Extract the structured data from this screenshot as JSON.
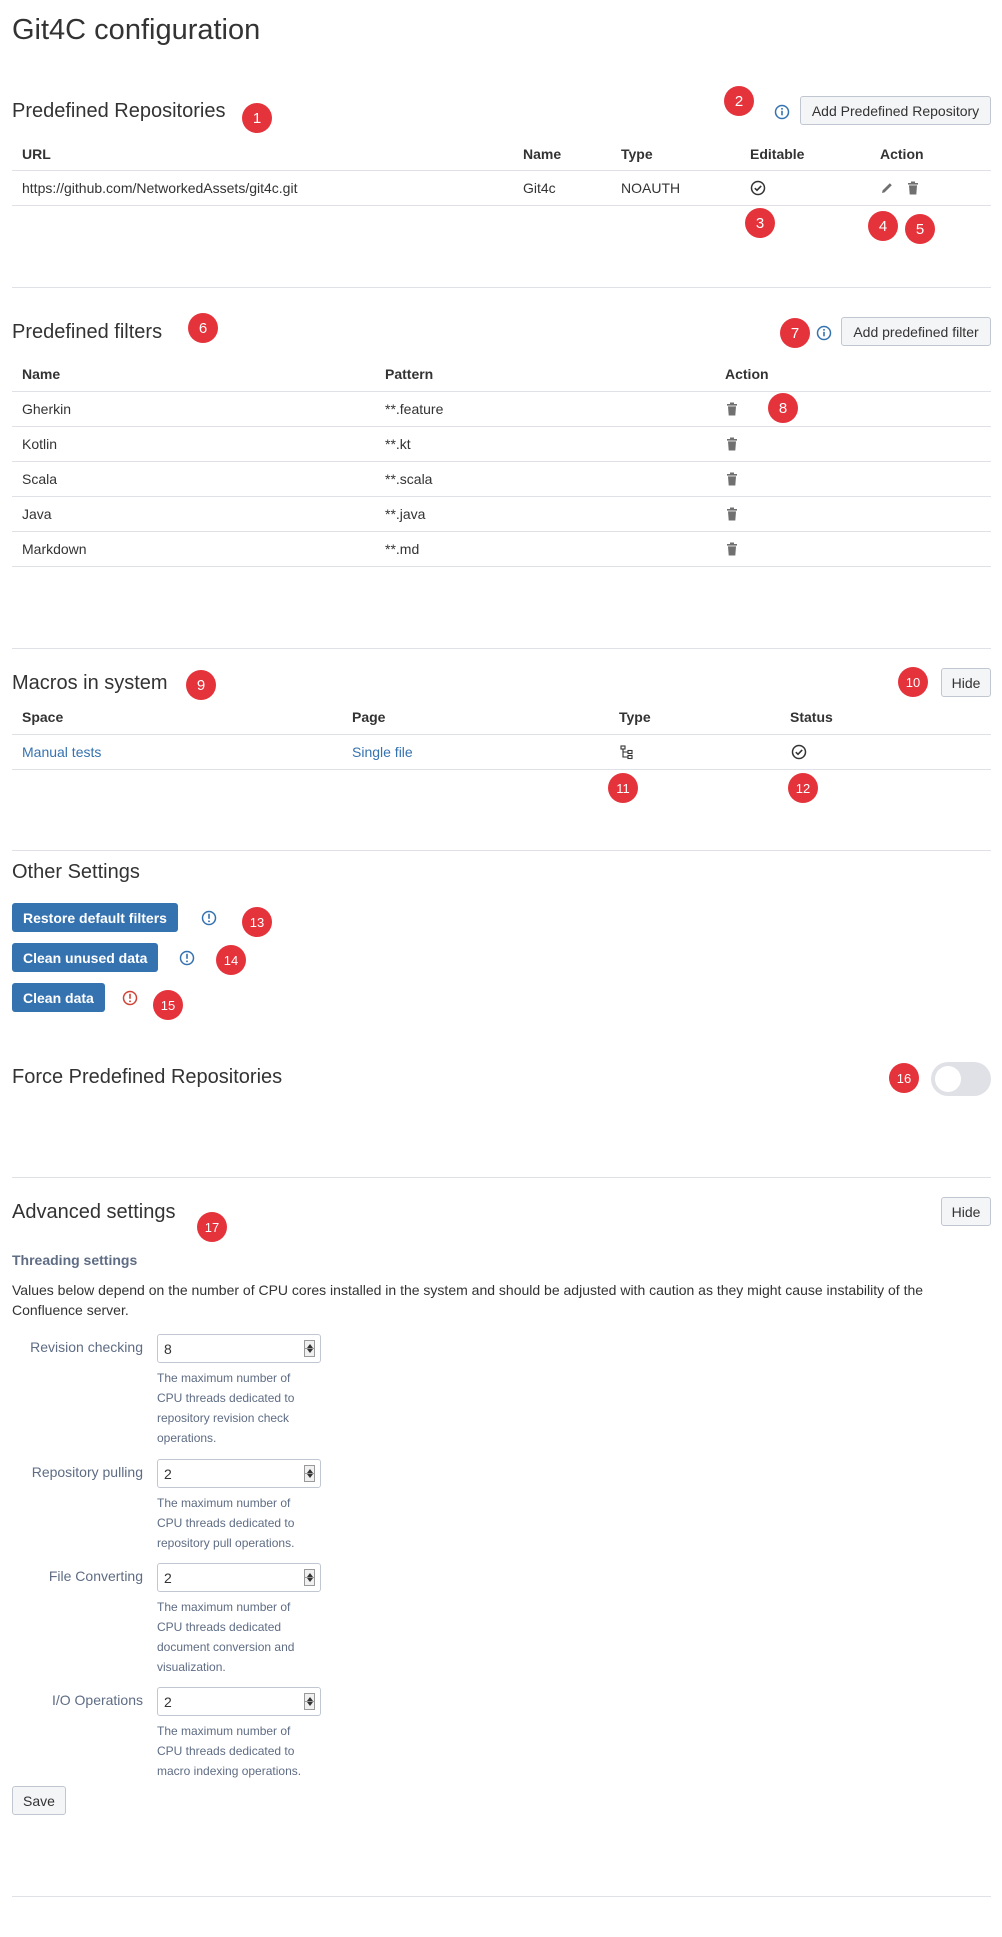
{
  "title": "Git4C configuration",
  "colors": {
    "accent": "#3572b0",
    "badge": "#e5333b",
    "danger": "#d04437"
  },
  "repositories": {
    "heading": "Predefined Repositories",
    "add_button": "Add Predefined Repository",
    "columns": [
      "URL",
      "Name",
      "Type",
      "Editable",
      "Action"
    ],
    "rows": [
      {
        "url": "https://github.com/NetworkedAssets/git4c.git",
        "name": "Git4c",
        "type": "NOAUTH",
        "editable": true
      }
    ]
  },
  "filters": {
    "heading": "Predefined filters",
    "add_button": "Add predefined filter",
    "columns": [
      "Name",
      "Pattern",
      "Action"
    ],
    "rows": [
      {
        "name": "Gherkin",
        "pattern": "**.feature"
      },
      {
        "name": "Kotlin",
        "pattern": "**.kt"
      },
      {
        "name": "Scala",
        "pattern": "**.scala"
      },
      {
        "name": "Java",
        "pattern": "**.java"
      },
      {
        "name": "Markdown",
        "pattern": "**.md"
      }
    ]
  },
  "macros": {
    "heading": "Macros in system",
    "hide_button": "Hide",
    "columns": [
      "Space",
      "Page",
      "Type",
      "Status"
    ],
    "rows": [
      {
        "space": "Manual tests",
        "page": "Single file",
        "type_icon": "tree-icon",
        "status_icon": "check-circle-icon"
      }
    ]
  },
  "other": {
    "heading": "Other Settings",
    "restore_button": "Restore default filters",
    "clean_unused_button": "Clean unused data",
    "clean_button": "Clean data"
  },
  "force": {
    "heading": "Force Predefined Repositories",
    "enabled": false
  },
  "advanced": {
    "heading": "Advanced settings",
    "hide_button": "Hide",
    "threading_heading": "Threading settings",
    "description": "Values below depend on the number of CPU cores installed in the system and should be adjusted with caution as they might cause instability of the Confluence server.",
    "fields": [
      {
        "label": "Revision checking",
        "value": "8",
        "help": "The maximum number of CPU threads dedicated to repository revision check operations."
      },
      {
        "label": "Repository pulling",
        "value": "2",
        "help": "The maximum number of CPU threads dedicated to repository pull operations."
      },
      {
        "label": "File Converting",
        "value": "2",
        "help": "The maximum number of CPU threads dedicated document conversion and visualization."
      },
      {
        "label": "I/O Operations",
        "value": "2",
        "help": "The maximum number of CPU threads dedicated to macro indexing operations."
      }
    ],
    "save_button": "Save"
  },
  "badges": [
    "1",
    "2",
    "3",
    "4",
    "5",
    "6",
    "7",
    "8",
    "9",
    "10",
    "11",
    "12",
    "13",
    "14",
    "15",
    "16",
    "17"
  ]
}
